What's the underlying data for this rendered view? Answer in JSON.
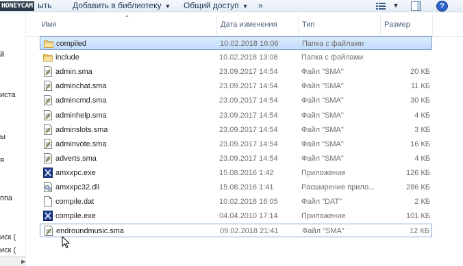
{
  "toolbar": {
    "watermark": "HONEYCAM",
    "open_label": "ыть",
    "library_label": "Добавить в библиотеку",
    "share_label": "Общий доступ",
    "more_label": "»",
    "help_label": "?"
  },
  "nav": {
    "items": [
      {
        "label": "й"
      },
      {
        "label": "иста"
      },
      {
        "label": "ы"
      },
      {
        "label": "я"
      },
      {
        "label": "ппа"
      },
      {
        "label": "иск ("
      },
      {
        "label": "иск ("
      }
    ]
  },
  "columns": {
    "name": "Имя",
    "date": "Дата изменения",
    "type": "Тип",
    "size": "Размер"
  },
  "files": [
    {
      "name": "compiled",
      "date": "10.02.2018 16:06",
      "type": "Папка с файлами",
      "size": "",
      "icon": "folder-icon"
    },
    {
      "name": "include",
      "date": "10.02.2018 13:08",
      "type": "Папка с файлами",
      "size": "",
      "icon": "folder-icon"
    },
    {
      "name": "admin.sma",
      "date": "23.09.2017 14:54",
      "type": "Файл \"SMA\"",
      "size": "20 КБ",
      "icon": "sma-file-icon"
    },
    {
      "name": "adminchat.sma",
      "date": "23.09.2017 14:54",
      "type": "Файл \"SMA\"",
      "size": "11 КБ",
      "icon": "sma-file-icon"
    },
    {
      "name": "admincmd.sma",
      "date": "23.09.2017 14:54",
      "type": "Файл \"SMA\"",
      "size": "30 КБ",
      "icon": "sma-file-icon"
    },
    {
      "name": "adminhelp.sma",
      "date": "23.09.2017 14:54",
      "type": "Файл \"SMA\"",
      "size": "4 КБ",
      "icon": "sma-file-icon"
    },
    {
      "name": "adminslots.sma",
      "date": "23.09.2017 14:54",
      "type": "Файл \"SMA\"",
      "size": "3 КБ",
      "icon": "sma-file-icon"
    },
    {
      "name": "adminvote.sma",
      "date": "23.09.2017 14:54",
      "type": "Файл \"SMA\"",
      "size": "16 КБ",
      "icon": "sma-file-icon"
    },
    {
      "name": "adverts.sma",
      "date": "23.09.2017 14:54",
      "type": "Файл \"SMA\"",
      "size": "4 КБ",
      "icon": "sma-file-icon"
    },
    {
      "name": "amxxpc.exe",
      "date": "15.08.2016 1:42",
      "type": "Приложение",
      "size": "126 КБ",
      "icon": "exe-icon"
    },
    {
      "name": "amxxpc32.dll",
      "date": "15.08.2016 1:41",
      "type": "Расширение прило...",
      "size": "286 КБ",
      "icon": "dll-icon"
    },
    {
      "name": "compile.dat",
      "date": "10.02.2018 16:05",
      "type": "Файл \"DAT\"",
      "size": "2 КБ",
      "icon": "dat-file-icon"
    },
    {
      "name": "compile.exe",
      "date": "04.04.2010 17:14",
      "type": "Приложение",
      "size": "101 КБ",
      "icon": "exe-icon"
    },
    {
      "name": "endroundmusic.sma",
      "date": "09.02.2018 21:41",
      "type": "Файл \"SMA\"",
      "size": "12 КБ",
      "icon": "sma-file-icon"
    }
  ],
  "selected_row": 0,
  "focused_row": 13,
  "colors": {
    "selection_top": "#dcebfc",
    "selection_bottom": "#c1dcfc",
    "selection_border": "#7da2ce",
    "folder": "#f2d27a"
  }
}
